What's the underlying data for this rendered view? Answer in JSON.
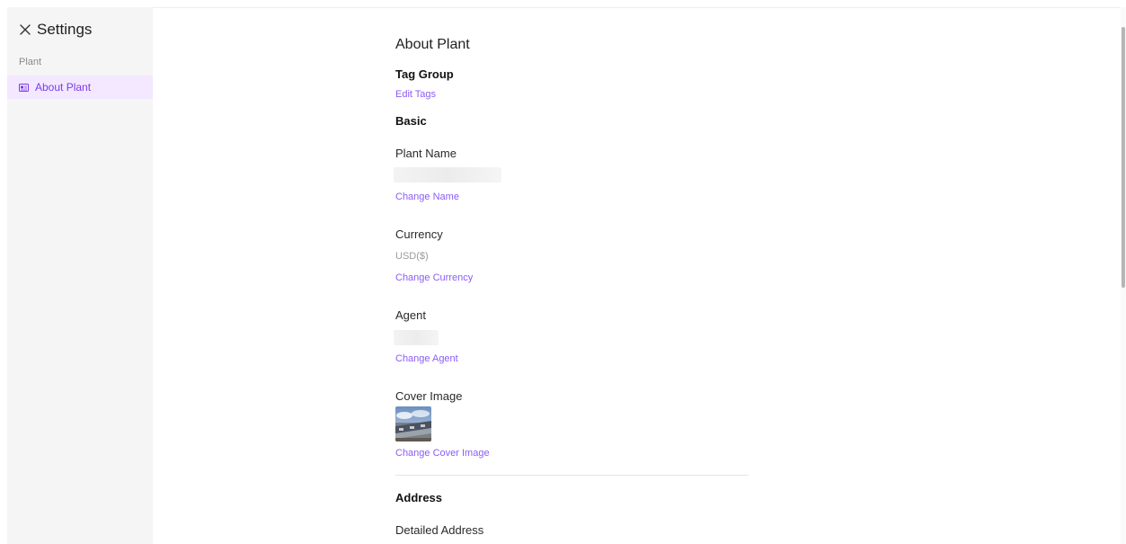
{
  "sidebar": {
    "title": "Settings",
    "section_label": "Plant",
    "items": [
      {
        "label": "About Plant",
        "icon": "id-card-icon",
        "active": true
      }
    ]
  },
  "main": {
    "page_title": "About Plant",
    "tag_group": {
      "heading": "Tag Group",
      "link": "Edit Tags"
    },
    "basic": {
      "heading": "Basic",
      "plant_name": {
        "label": "Plant Name",
        "link": "Change Name"
      },
      "currency": {
        "label": "Currency",
        "value": "USD($)",
        "link": "Change Currency"
      },
      "agent": {
        "label": "Agent",
        "link": "Change Agent"
      },
      "cover_image": {
        "label": "Cover Image",
        "link": "Change Cover Image"
      }
    },
    "address": {
      "heading": "Address",
      "detailed_label": "Detailed Address"
    }
  },
  "colors": {
    "accent": "#8b5cf6",
    "active_bg": "#f3e8ff",
    "sidebar_bg": "#f5f5f5",
    "muted_text": "#9a9a9a"
  }
}
